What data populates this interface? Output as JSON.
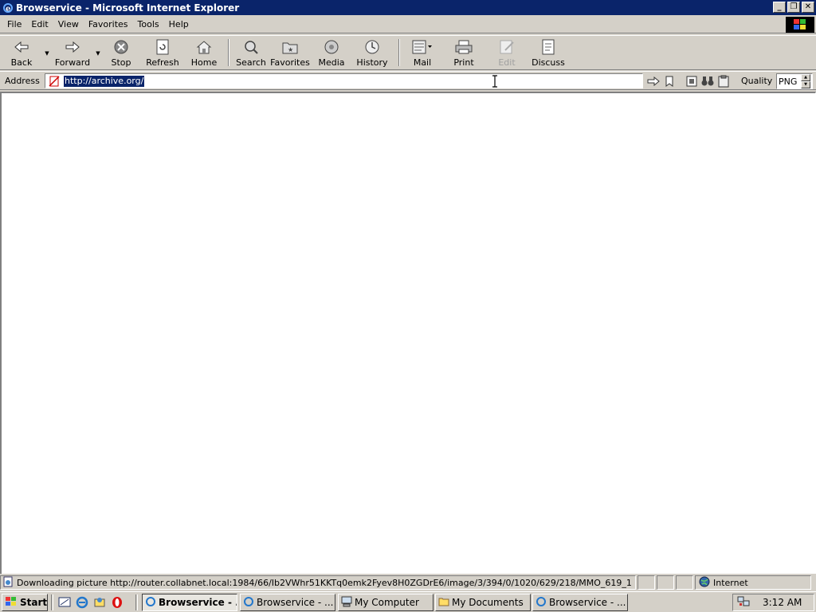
{
  "window": {
    "title": "Browservice - Microsoft Internet Explorer",
    "icon": "ie-icon",
    "controls": [
      "minimize",
      "restore",
      "close"
    ]
  },
  "menubar": {
    "items": [
      "File",
      "Edit",
      "View",
      "Favorites",
      "Tools",
      "Help"
    ]
  },
  "toolbar": {
    "back": "Back",
    "forward": "Forward",
    "stop": "Stop",
    "refresh": "Refresh",
    "home": "Home",
    "search": "Search",
    "favorites": "Favorites",
    "media": "Media",
    "history": "History",
    "mail": "Mail",
    "print": "Print",
    "edit": "Edit",
    "discuss": "Discuss"
  },
  "addressbar": {
    "label": "Address",
    "url": "http://archive.org/",
    "quality_label": "Quality",
    "quality_value": "PNG"
  },
  "statusbar": {
    "text": "Downloading picture http://router.collabnet.local:1984/66/Ib2VWhr51KKTq0emk2Fyev8H0ZGDrE6/image/3/394/0/1020/629/218/MMO_619_1",
    "zone": "Internet"
  },
  "taskbar": {
    "start": "Start",
    "tasks": [
      {
        "label": "Browservice - ...",
        "active": true
      },
      {
        "label": "Browservice - ...",
        "active": false
      },
      {
        "label": "My Computer",
        "active": false
      },
      {
        "label": "My Documents",
        "active": false
      },
      {
        "label": "Browservice - ...",
        "active": false
      }
    ],
    "clock": "3:12 AM"
  },
  "colors": {
    "titlebar": "#0a246a",
    "chrome": "#d4d0c8",
    "selection": "#0a246a"
  }
}
